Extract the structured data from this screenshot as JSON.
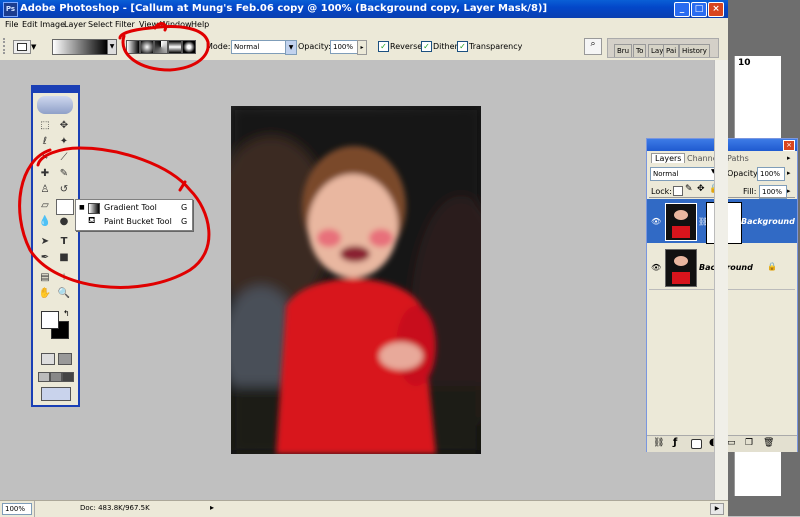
{
  "window": {
    "title": "Adobe Photoshop - [Callum at Mung's Feb.06 copy @ 100% (Background copy, Layer Mask/8)]",
    "app_icon": "ps-icon",
    "minimize": "_",
    "maximize": "□",
    "close": "×"
  },
  "menu": [
    "File",
    "Edit",
    "Image",
    "Layer",
    "Select",
    "Filter",
    "View",
    "Window",
    "Help"
  ],
  "options": {
    "mode_label": "Mode:",
    "mode_value": "Normal",
    "opacity_label": "Opacity:",
    "opacity_value": "100%",
    "reverse_label": "Reverse",
    "dither_label": "Dither",
    "transparency_label": "Transparency",
    "palette_tabs": [
      "Bru",
      "To",
      "Lay",
      "Pai",
      "History"
    ]
  },
  "ruler_label": "10",
  "flyout": {
    "items": [
      {
        "label": "Gradient Tool",
        "key": "G"
      },
      {
        "label": "Paint Bucket Tool",
        "key": "G"
      }
    ]
  },
  "layers": {
    "tabs": [
      "Layers",
      "Channels",
      "Paths"
    ],
    "blend": "Normal",
    "opacity_label": "Opacity:",
    "opacity_value": "100%",
    "lock_label": "Lock:",
    "fill_label": "Fill:",
    "fill_value": "100%",
    "rows": [
      {
        "name": "Background copy",
        "selected": true
      },
      {
        "name": "Background",
        "selected": false
      }
    ]
  },
  "status": {
    "zoom": "100%",
    "doc": "Doc: 483.8K/967.5K"
  },
  "colors": {
    "title_bar": "#0a4fd0",
    "selection": "#316ac5",
    "annotation_red": "#e00000",
    "toolbox_border": "#1a3fb5"
  }
}
